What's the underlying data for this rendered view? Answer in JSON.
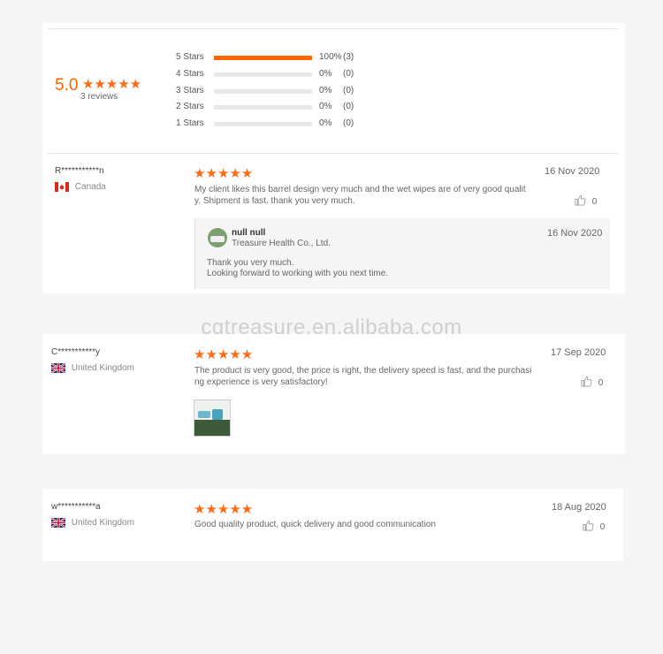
{
  "summary": {
    "score": "5.0",
    "stars": "★★★★★",
    "reviews_label": "3 reviews",
    "breakdown": [
      {
        "label": "5 Stars",
        "percent": "100%",
        "count": "(3)",
        "fill": 1.0
      },
      {
        "label": "4 Stars",
        "percent": "0%",
        "count": "(0)",
        "fill": 0
      },
      {
        "label": "3 Stars",
        "percent": "0%",
        "count": "(0)",
        "fill": 0
      },
      {
        "label": "2 Stars",
        "percent": "0%",
        "count": "(0)",
        "fill": 0
      },
      {
        "label": "1 Stars",
        "percent": "0%",
        "count": "(0)",
        "fill": 0
      }
    ]
  },
  "reviews": [
    {
      "user": "R***********n",
      "country": "Canada",
      "flag_icon": "canada-flag-icon",
      "stars": "★★★★★",
      "date": "16 Nov 2020",
      "text_line1": "My client likes this barrel design very much and the wet wipes are of very good qualit",
      "text_line2": "y. Shipment is fast. thank you very much.",
      "likes": "0",
      "reply": {
        "name": "null null",
        "company": "Treasure Health Co., Ltd.",
        "date": "16 Nov 2020",
        "line1": "Thank you very much.",
        "line2": "Looking forward to working with you next time."
      }
    },
    {
      "user": "C***********y",
      "country": "United Kingdom",
      "flag_icon": "uk-flag-icon",
      "stars": "★★★★★",
      "date": "17 Sep 2020",
      "text_line1": "The product is very good, the price is right, the delivery speed is fast, and the purchasi",
      "text_line2": "ng experience is very satisfactory!",
      "likes": "0"
    },
    {
      "user": "w***********a",
      "country": "United Kingdom",
      "flag_icon": "uk-flag-icon",
      "stars": "★★★★★",
      "date": "18 Aug 2020",
      "text_line1": "Good quality product, quick delivery and good communication",
      "likes": "0"
    }
  ],
  "watermark": "cqtreasure.en.alibaba.com",
  "colors": {
    "accent": "#ff6600",
    "bar_bg": "#e8e8e8",
    "page_bg": "#f5f5f5"
  }
}
